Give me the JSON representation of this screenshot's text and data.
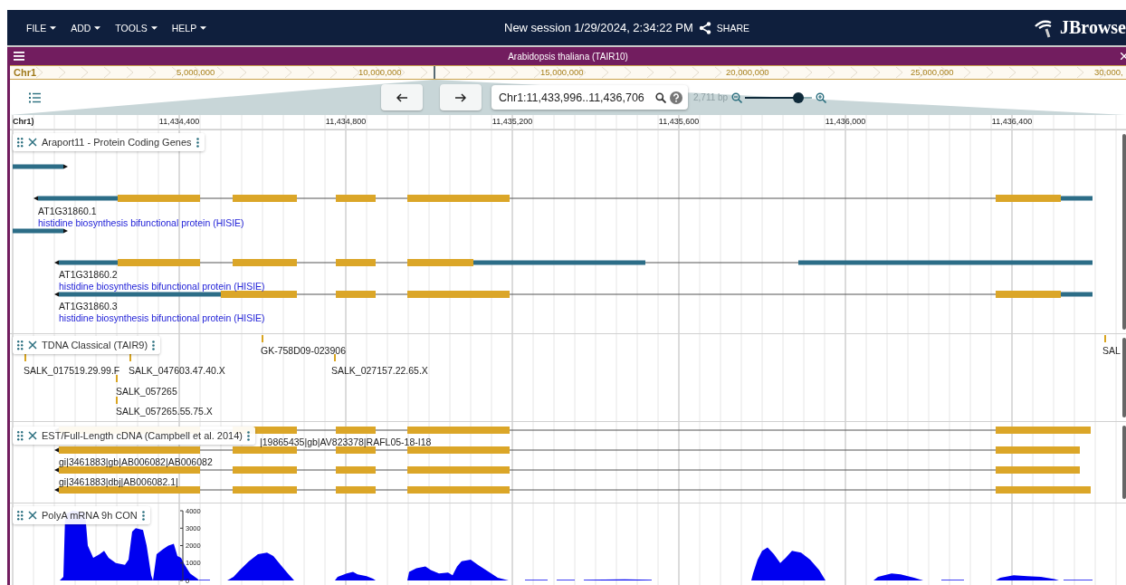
{
  "app_bar": {
    "menus": [
      "FILE",
      "ADD",
      "TOOLS",
      "HELP"
    ],
    "session_title": "New session 1/29/2024, 2:34:22 PM",
    "share_label": "SHARE",
    "logo_text": "JBrowse"
  },
  "view": {
    "title": "Arabidopsis thaliana (TAIR10)",
    "overview": {
      "chromosome": "Chr1",
      "ticks": [
        "5,000,000",
        "10,000,000",
        "15,000,000",
        "20,000,000",
        "25,000,000",
        "30,000,"
      ]
    },
    "location": "Chr1:11,433,996..11,436,706",
    "span": "2,711 bp",
    "zoom": {
      "level": 0.8
    },
    "ruler": {
      "chromosome": "Chr1)",
      "ticks": [
        "11,434,400",
        "11,434,800",
        "11,435,200",
        "11,435,600",
        "11,436,000",
        "11,436,400"
      ]
    },
    "tracks": [
      {
        "kind": "genes",
        "name": "Araport11 - Protein Coding Genes",
        "features": [
          {
            "id": "AT1G31860.1",
            "description": "histidine biosynthesis bifunctional protein (HISIE)"
          },
          {
            "id": "AT1G31860.2",
            "description": "histidine biosynthesis bifunctional protein (HISIE)"
          },
          {
            "id": "AT1G31860.3",
            "description": "histidine biosynthesis bifunctional protein (HISIE)"
          }
        ]
      },
      {
        "kind": "insertions",
        "name": "TDNA Classical (TAIR9)",
        "features": [
          "SALK_017519.29.99.F",
          "SALK_047603.47.40.X",
          "GK-758D09-023906",
          "SALK_027157.22.65.X",
          "SALK_057265",
          "SALK_057265.55.75.X",
          "SAL"
        ]
      },
      {
        "kind": "alignments",
        "name": "EST/Full-Length cDNA (Campbell et al. 2014)",
        "features": [
          "|19865435|gb|AV823378|RAFL05-18-I18",
          "gi|3461883|gb|AB006082|AB006082",
          "gi|3461883|dbj|AB006082.1|"
        ]
      },
      {
        "kind": "coverage",
        "name": "PolyA mRNA 9h CON",
        "yticks": [
          "4000",
          "3000",
          "2000",
          "1000",
          "0"
        ]
      }
    ]
  }
}
